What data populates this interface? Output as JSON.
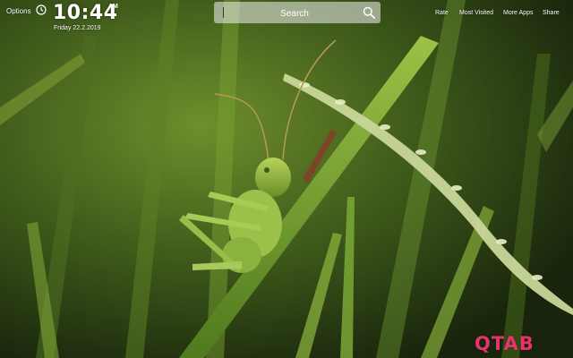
{
  "header": {
    "options_label": "Options",
    "time": "10:44",
    "ampm": "AM",
    "date": "Friday  22.2.2019"
  },
  "search": {
    "placeholder": "Search"
  },
  "nav": {
    "rate": "Rate",
    "most_visited": "Most Visited",
    "more_apps": "More Apps",
    "share": "Share"
  },
  "brand": {
    "logo_text": "QTAB",
    "logo_color": "#e6336b"
  },
  "background": {
    "subject": "grasshopper-on-grass-wallpaper"
  }
}
